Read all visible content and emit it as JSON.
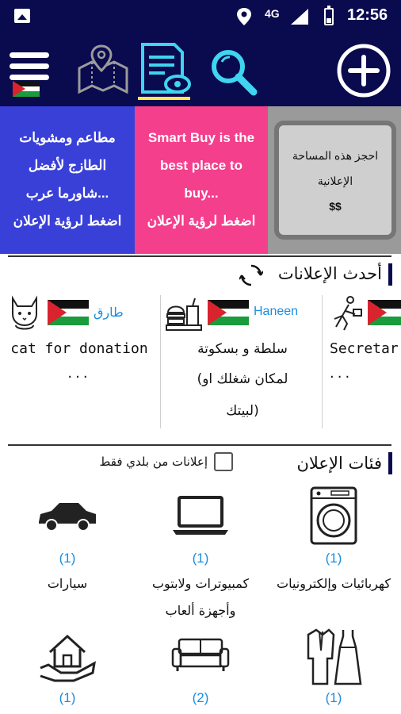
{
  "status_bar": {
    "network": "4G",
    "time": "12:56"
  },
  "toolbar": {
    "items": [
      {
        "icon": "menu-icon"
      },
      {
        "icon": "map-pin-icon"
      },
      {
        "icon": "list-view-icon",
        "active": true
      },
      {
        "icon": "search-icon"
      },
      {
        "icon": "add-circle-icon"
      }
    ],
    "active_color": "#ffe94a",
    "background": "#0a0a4f"
  },
  "banners": [
    {
      "color": "#3940d8",
      "lines": [
        "مطاعم ومشويات",
        "الطازج لأفضل",
        "شاورما عرب...",
        "اضغط لرؤية الإعلان"
      ]
    },
    {
      "color": "#f43f8c",
      "lines": [
        "Smart Buy is the",
        "best place to",
        "buy...",
        "اضغط لرؤية الإعلان"
      ]
    },
    {
      "color": "#9a9a9a",
      "lines": [
        "احجز هذه المساحة",
        "الإعلانية",
        "$$"
      ]
    }
  ],
  "latest_ads": {
    "title": "أحدث الإعلانات",
    "items": [
      {
        "user": "طارق",
        "title_lines": [
          "cat for donation"
        ],
        "more": "..."
      },
      {
        "user": "Haneen",
        "title_lines": [
          "سلطة و بسكوتة",
          "(لمكان شغلك او",
          "لبيتك)"
        ]
      },
      {
        "user": "",
        "title_lines": [
          "Secretar"
        ],
        "more": "..."
      }
    ]
  },
  "categories": {
    "title": "فئات الإعلان",
    "only_local_label": "إعلانات من بلدي فقط",
    "only_local_checked": false,
    "items": [
      {
        "icon": "washing-machine-icon",
        "count": "(1)",
        "name_lines": [
          "كهربائيات وإلكترونيات"
        ]
      },
      {
        "icon": "laptop-icon",
        "count": "(1)",
        "name_lines": [
          "كمبيوترات ولابتوب",
          "وأجهزة ألعاب"
        ]
      },
      {
        "icon": "car-icon",
        "count": "(1)",
        "name_lines": [
          "سيارات"
        ]
      },
      {
        "icon": "clothes-icon",
        "count": "(1)",
        "name_lines": []
      },
      {
        "icon": "sofa-icon",
        "count": "(2)",
        "name_lines": []
      },
      {
        "icon": "house-hand-icon",
        "count": "(1)",
        "name_lines": []
      }
    ]
  },
  "colors": {
    "accent_blue": "#1a8de0",
    "header_navy": "#0a0a4f"
  }
}
